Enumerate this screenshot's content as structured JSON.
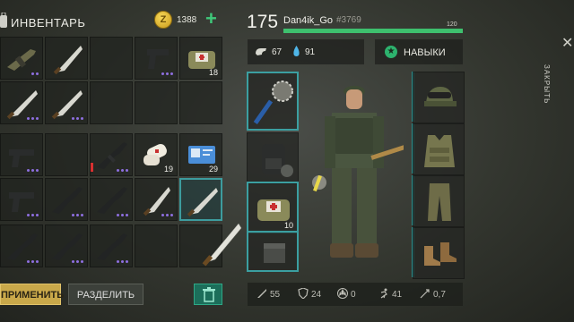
{
  "inventory": {
    "title": "ИНВЕНТАРЬ",
    "currency": "1388",
    "coin_symbol": "Z",
    "add_symbol": "+",
    "quantities": {
      "medkit_bag": "18",
      "bandage": "19",
      "card": "29"
    },
    "apply_label": "ПРИМЕНИТЬ",
    "split_label": "РАЗДЕЛИТЬ"
  },
  "player": {
    "level": "175",
    "name": "Dan4ik_Go",
    "id": "#3769",
    "max_hp": "120",
    "hunger": "67",
    "water": "91",
    "skills_label": "НАВЫКИ"
  },
  "equipment": {
    "bag_qty": "10"
  },
  "stats": {
    "attack": "55",
    "defense": "24",
    "radiation": "0",
    "speed": "41",
    "crit": "0,7"
  },
  "side": {
    "close_label": "ЗАКРЫТЬ",
    "close_icon": "close-icon"
  },
  "colors": {
    "accent": "#3b9fa1",
    "hp": "#3ec06e",
    "apply": "#c9a84a",
    "skills": "#2db36e",
    "rarity": "#8e6fe0"
  }
}
